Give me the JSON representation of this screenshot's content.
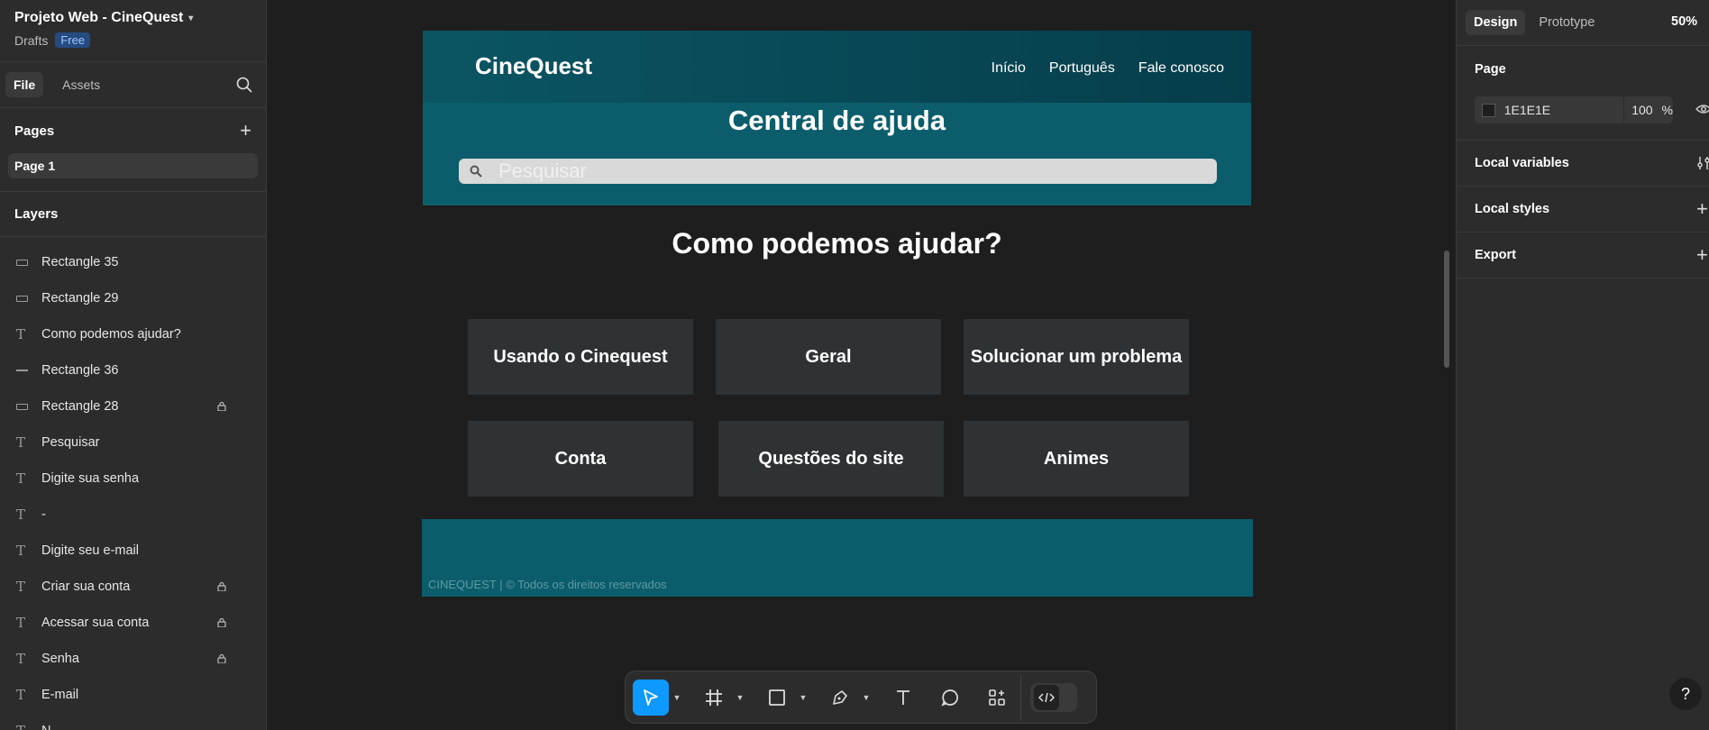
{
  "project": {
    "title": "Projeto Web - CineQuest",
    "location": "Drafts",
    "plan_badge": "Free"
  },
  "left_tabs": {
    "file": "File",
    "assets": "Assets"
  },
  "pages": {
    "header": "Pages",
    "items": [
      {
        "label": "Page 1"
      }
    ]
  },
  "layers": {
    "header": "Layers",
    "items": [
      {
        "label": "Rectangle 35",
        "type": "rectangle",
        "locked": false
      },
      {
        "label": "Rectangle 29",
        "type": "rectangle",
        "locked": false
      },
      {
        "label": "Como podemos ajudar?",
        "type": "text",
        "locked": false
      },
      {
        "label": "Rectangle 36",
        "type": "line",
        "locked": false
      },
      {
        "label": "Rectangle 28",
        "type": "rectangle",
        "locked": true
      },
      {
        "label": "Pesquisar",
        "type": "text",
        "locked": false
      },
      {
        "label": "Digite sua senha",
        "type": "text",
        "locked": false
      },
      {
        "label": "-",
        "type": "text",
        "locked": false
      },
      {
        "label": "Digite seu e-mail",
        "type": "text",
        "locked": false
      },
      {
        "label": "Criar sua conta",
        "type": "text",
        "locked": true
      },
      {
        "label": "Acessar sua conta",
        "type": "text",
        "locked": true
      },
      {
        "label": "Senha",
        "type": "text",
        "locked": true
      },
      {
        "label": "E-mail",
        "type": "text",
        "locked": false
      },
      {
        "label": "N",
        "type": "text",
        "locked": false
      }
    ]
  },
  "site": {
    "logo": "CineQuest",
    "nav": [
      "Início",
      "Português",
      "Fale conosco"
    ],
    "hero_title": "Central de ajuda",
    "search_placeholder": "Pesquisar",
    "help_title": "Como podemos ajudar?",
    "cards": [
      "Usando o Cinequest",
      "Geral",
      "Solucionar um problema",
      "Conta",
      "Questões do site",
      "Animes"
    ],
    "footer": "CINEQUEST |  © Todos os direitos reservados"
  },
  "toolbar": {
    "tools": [
      "move-tool",
      "frame-tool",
      "shape-tool",
      "pen-tool",
      "text-tool",
      "comment-tool",
      "actions-tool",
      "dev-mode-toggle"
    ]
  },
  "right_panel": {
    "tabs": {
      "design": "Design",
      "prototype": "Prototype"
    },
    "zoom": "50%",
    "page": {
      "title": "Page",
      "color_hex": "1E1E1E",
      "opacity": "100",
      "opacity_unit": "%"
    },
    "local_variables": "Local variables",
    "local_styles": "Local styles",
    "export": "Export",
    "help": "?"
  },
  "colors": {
    "ui_panel": "#2c2c2c",
    "canvas": "#1e1e1e",
    "accent_blue": "#0d99ff",
    "site_teal": "#0b5d6b",
    "site_header_dark": "#063d4a",
    "card_bg": "#2e3234"
  }
}
